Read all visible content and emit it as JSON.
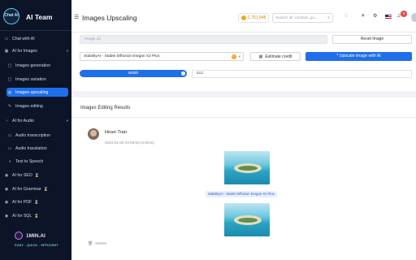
{
  "sidebar": {
    "brand": {
      "logo_text": "Chat AI",
      "title": "AI Team"
    },
    "items": [
      {
        "label": "Chat with AI",
        "icon": "chat-icon",
        "icon_glyph": "▭"
      },
      {
        "label": "AI for Images",
        "icon": "image-icon",
        "icon_glyph": "▣",
        "caret": "▾"
      },
      {
        "label": "Images generation",
        "icon": "image-gen-icon",
        "icon_glyph": "▢"
      },
      {
        "label": "Images variation",
        "icon": "image-variation-icon",
        "icon_glyph": "▢"
      },
      {
        "label": "Images upscaling",
        "icon": "upscale-icon",
        "icon_glyph": "◎"
      },
      {
        "label": "Images editing",
        "icon": "edit-icon",
        "icon_glyph": "✎"
      },
      {
        "label": "AI for Audio",
        "icon": "audio-icon",
        "icon_glyph": "◔",
        "caret": "▾"
      },
      {
        "label": "Audio transcription",
        "icon": "transcription-icon",
        "icon_glyph": "▭"
      },
      {
        "label": "Audio translation",
        "icon": "translation-icon",
        "icon_glyph": "▭"
      },
      {
        "label": "Text to Speech",
        "icon": "speech-icon",
        "icon_glyph": "◖"
      },
      {
        "label": "AI for SEO",
        "icon": "seo-icon",
        "icon_glyph": "◉",
        "tag": "⌛"
      },
      {
        "label": "AI for Grammar",
        "icon": "grammar-icon",
        "icon_glyph": "◉",
        "tag": "⌛"
      },
      {
        "label": "AI for PDF",
        "icon": "pdf-icon",
        "icon_glyph": "◉",
        "tag": "⌛"
      },
      {
        "label": "AI for SQL",
        "icon": "sql-icon",
        "icon_glyph": "◉",
        "tag": "⌛"
      }
    ],
    "footer": {
      "logo_text": "1MIN.AI",
      "tagline": "EASY - QUICK - EFFICIENT"
    }
  },
  "header": {
    "menu_icon": "☰",
    "title": "Images Upscaling",
    "credits": "1,761,048",
    "search_placeholder": "Search all: content, gu...",
    "search_icon": "⌕",
    "chat_icon": "◌",
    "theme_icon": "☀",
    "settings_icon": "⚙",
    "bell_icon": "♫",
    "notifications_count": "0"
  },
  "controls": {
    "image_url_placeholder": "Image url",
    "reset_label": "Reset Image",
    "model": "StabilityAI - Stable Diffusion Esrgan X2 Plus",
    "warn_glyph": "!",
    "chevron": "▾",
    "estimate_label": "Estimate credit",
    "calc_glyph": "▦",
    "upscale_label": "* Upscale image with AI",
    "width_label": "Width",
    "width_value": "512"
  },
  "results": {
    "title": "Images Editing Results",
    "user_name": "Hoan Tran",
    "timestamp": "2024-01-09 20:06:53 (2.904s)",
    "model_tag": "StabilityAI - Stable Diffusion Esrgan X2 Plus",
    "delete_label": "Delete",
    "trash_glyph": "🗑"
  },
  "colors": {
    "accent": "#1f6feb",
    "sidebar_bg": "#0c1527",
    "credits": "#e57c00"
  }
}
